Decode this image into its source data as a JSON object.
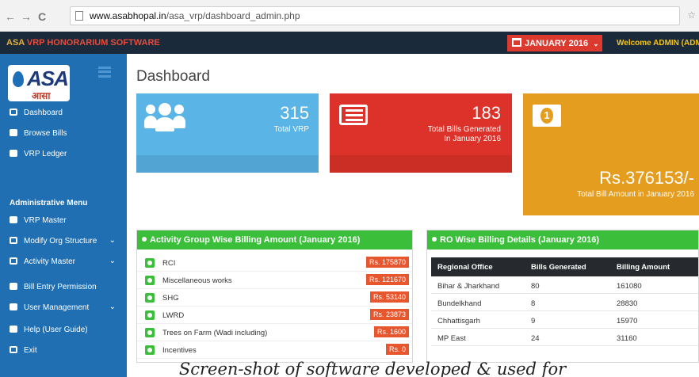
{
  "browser": {
    "url_host": "www.asabhopal.in",
    "url_path": "/asa_vrp/dashboard_admin.php"
  },
  "header": {
    "app_name_part1": "ASA",
    "app_name_part2": " VRP HONORARIUM SOFTWARE",
    "month_label": "JANUARY 2016",
    "welcome": "Welcome ADMIN (ADMIN)"
  },
  "sidebar": {
    "logo_text": "ASA",
    "logo_sub": "आसा",
    "items": [
      {
        "label": "Dashboard",
        "icon": "dashboard-icon"
      },
      {
        "label": "Browse Bills",
        "icon": "print-icon"
      },
      {
        "label": "VRP Ledger",
        "icon": "print-icon"
      }
    ],
    "admin_heading": "Administrative Menu",
    "admin_items": [
      {
        "label": "VRP Master",
        "icon": "user-icon",
        "chevron": false
      },
      {
        "label": "Modify Org Structure",
        "icon": "bookmark-icon",
        "chevron": true
      },
      {
        "label": "Activity Master",
        "icon": "bookmark-icon",
        "chevron": true
      },
      {
        "label": "Bill Entry Permission",
        "icon": "user-icon",
        "chevron": false
      },
      {
        "label": "User Management",
        "icon": "user-icon",
        "chevron": true
      },
      {
        "label": "Help (User Guide)",
        "icon": "book-icon",
        "chevron": false
      },
      {
        "label": "Exit",
        "icon": "exit-icon",
        "chevron": false
      }
    ]
  },
  "main": {
    "title": "Dashboard",
    "tiles": [
      {
        "value": "315",
        "label": "Total VRP",
        "color": "#5ab4e5"
      },
      {
        "value": "183",
        "label1": "Total Bills Generated",
        "label2": "In January 2016",
        "color": "#dd3229"
      },
      {
        "value": "Rs.376153/-",
        "label": "Total Bill Amount in January 2016",
        "color": "#e59d1f"
      }
    ],
    "activity_panel": {
      "title": "Activity Group Wise Billing Amount (January 2016)",
      "rows": [
        {
          "name": "RCI",
          "amount": "Rs. 175870"
        },
        {
          "name": "Miscellaneous works",
          "amount": "Rs. 121670"
        },
        {
          "name": "SHG",
          "amount": "Rs. 53140"
        },
        {
          "name": "LWRD",
          "amount": "Rs. 23873"
        },
        {
          "name": "Trees on Farm (Wadi including)",
          "amount": "Rs. 1600"
        },
        {
          "name": "Incentives",
          "amount": "Rs. 0"
        }
      ]
    },
    "ro_panel": {
      "title": "RO Wise Billing Details (January 2016)",
      "headers": [
        "Regional Office",
        "Bills Generated",
        "Billing Amount"
      ],
      "rows": [
        [
          "Bihar & Jharkhand",
          "80",
          "161080"
        ],
        [
          "Bundelkhand",
          "8",
          "28830"
        ],
        [
          "Chhattisgarh",
          "9",
          "15970"
        ],
        [
          "MP East",
          "24",
          "31160"
        ]
      ]
    }
  },
  "caption": "Screen-shot of software developed & used for"
}
